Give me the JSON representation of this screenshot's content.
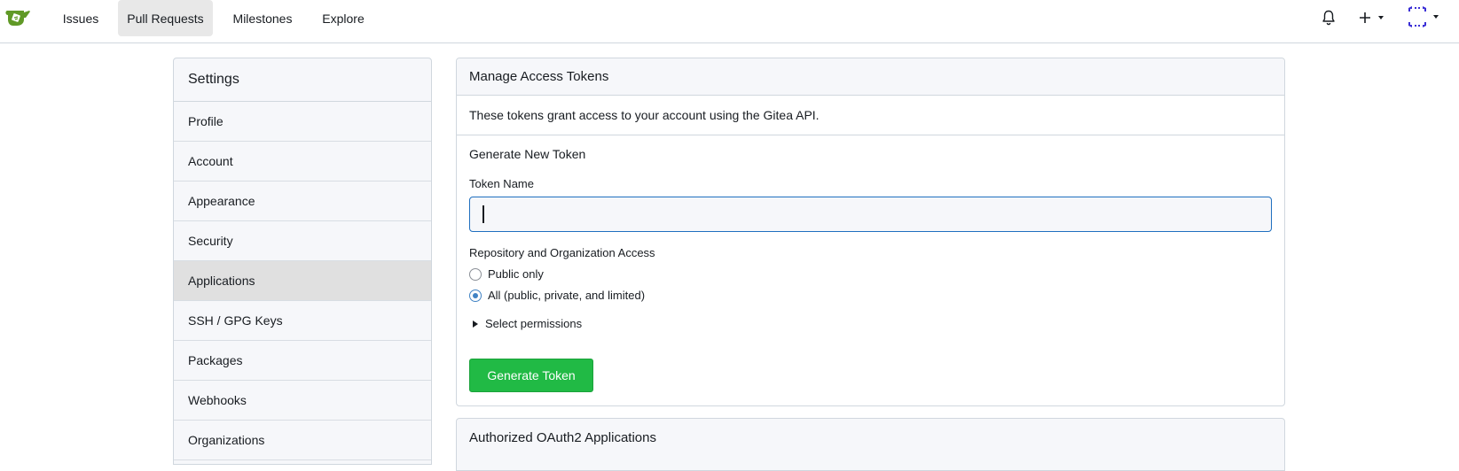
{
  "nav": {
    "items": [
      {
        "label": "Issues"
      },
      {
        "label": "Pull Requests"
      },
      {
        "label": "Milestones"
      },
      {
        "label": "Explore"
      }
    ],
    "active": "Pull Requests"
  },
  "sidebar": {
    "title": "Settings",
    "items": [
      {
        "label": "Profile"
      },
      {
        "label": "Account"
      },
      {
        "label": "Appearance"
      },
      {
        "label": "Security"
      },
      {
        "label": "Applications"
      },
      {
        "label": "SSH / GPG Keys"
      },
      {
        "label": "Packages"
      },
      {
        "label": "Webhooks"
      },
      {
        "label": "Organizations"
      }
    ],
    "active": "Applications"
  },
  "tokens": {
    "title": "Manage Access Tokens",
    "description": "These tokens grant access to your account using the Gitea API.",
    "generate_title": "Generate New Token",
    "token_name_label": "Token Name",
    "token_name_value": "",
    "access_label": "Repository and Organization Access",
    "options": [
      {
        "label": "Public only",
        "checked": false
      },
      {
        "label": "All (public, private, and limited)",
        "checked": true
      }
    ],
    "select_permissions": "Select permissions",
    "generate_button": "Generate Token"
  },
  "oauth": {
    "title": "Authorized OAuth2 Applications"
  },
  "colors": {
    "accent": "#21ba45",
    "focus": "#1f6fbf",
    "avatar": "#3b2fd6"
  },
  "icons": {
    "logo": "gitea-logo-icon",
    "bell": "bell-icon",
    "plus": "plus-icon",
    "avatar": "identicon-avatar-icon"
  }
}
